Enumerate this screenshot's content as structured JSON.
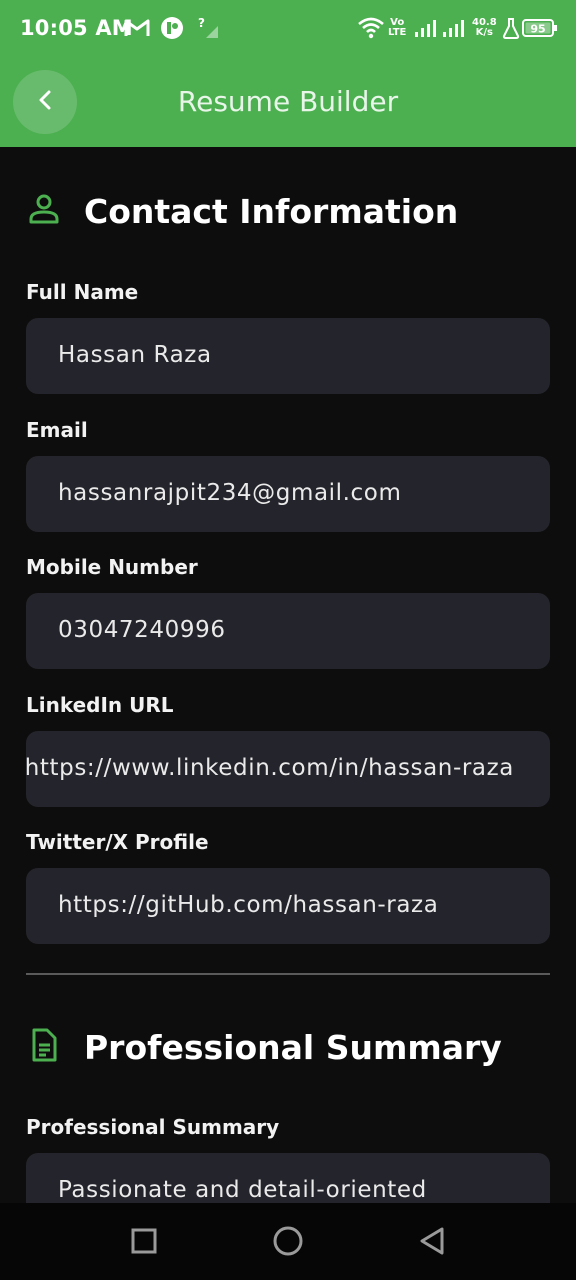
{
  "status_bar": {
    "time": "10:05 AM",
    "icons": [
      "gmail-icon",
      "app-notification-icon",
      "no-sim-signal-icon",
      "wifi-icon",
      "volte-icon",
      "signal-icon",
      "signal-icon",
      "network-speed",
      "lab-icon",
      "battery-icon"
    ],
    "volte_top": "Vo",
    "volte_bottom": "LTE",
    "speed_value": "40.8",
    "speed_unit": "K/s",
    "battery": "95"
  },
  "app_bar": {
    "title": "Resume Builder",
    "back_icon": "chevron-left-icon"
  },
  "contact_section": {
    "icon": "person-icon",
    "title": "Contact Information",
    "fields": [
      {
        "label": "Full Name",
        "value": "Hassan Raza"
      },
      {
        "label": "Email",
        "value": "hassanrajpit234@gmail.com"
      },
      {
        "label": "Mobile Number",
        "value": "03047240996"
      },
      {
        "label": "LinkedIn URL",
        "value": "https://www.linkedin.com/in/hassan-raza"
      },
      {
        "label": "Twitter/X Profile",
        "value": "https://gitHub.com/hassan-raza"
      }
    ]
  },
  "summary_section": {
    "icon": "document-icon",
    "title": "Professional Summary",
    "field": {
      "label": "Professional Summary",
      "value": "Passionate and detail-oriented"
    }
  },
  "nav_bar": {
    "items": [
      "recents-square-icon",
      "home-circle-icon",
      "back-triangle-icon"
    ]
  },
  "colors": {
    "accent": "#4caf50",
    "background": "#0d0d0d",
    "field_background": "#24242c"
  }
}
